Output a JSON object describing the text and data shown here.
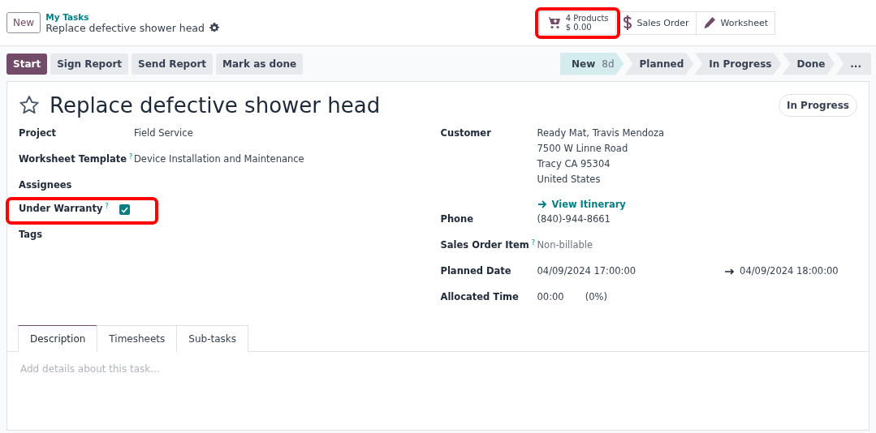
{
  "breadcrumb": {
    "new_button": "New",
    "parent": "My Tasks",
    "current": "Replace defective shower head"
  },
  "smart_buttons": [
    {
      "kind": "products",
      "line1": "4 Products",
      "line2": "$ 0.00",
      "highlighted": true
    },
    {
      "kind": "sales_order",
      "label": "Sales Order",
      "highlighted": false
    },
    {
      "kind": "worksheet",
      "label": "Worksheet",
      "highlighted": false
    }
  ],
  "actions": [
    {
      "label": "Start",
      "primary": true
    },
    {
      "label": "Sign Report",
      "primary": false
    },
    {
      "label": "Send Report",
      "primary": false
    },
    {
      "label": "Mark as done",
      "primary": false
    }
  ],
  "stages": [
    {
      "label": "New",
      "count": "8d",
      "selected": true
    },
    {
      "label": "Planned",
      "selected": false
    },
    {
      "label": "In Progress",
      "selected": false
    },
    {
      "label": "Done",
      "selected": false
    },
    {
      "label": "...",
      "selected": false
    }
  ],
  "record": {
    "title": "Replace defective shower head",
    "starred": false,
    "status": "In Progress"
  },
  "left_fields": [
    {
      "kind": "text",
      "label": "Project",
      "value": "Field Service"
    },
    {
      "kind": "text",
      "label": "Worksheet Template",
      "help": "?",
      "value": "Device Installation and Maintenance"
    },
    {
      "kind": "empty",
      "label": "Assignees"
    },
    {
      "kind": "checkbox",
      "label": "Under Warranty",
      "help": "?",
      "checked": true,
      "highlighted": true
    },
    {
      "kind": "empty",
      "label": "Tags"
    }
  ],
  "right_fields": [
    {
      "kind": "address",
      "label": "Customer",
      "lines": [
        "Ready Mat, Travis Mendoza",
        "7500 W Linne Road",
        "Tracy CA 95304",
        "United States"
      ],
      "link": "View Itinerary"
    },
    {
      "kind": "text",
      "label": "Phone",
      "value": "(840)-944-8661"
    },
    {
      "kind": "text",
      "label": "Sales Order Item",
      "help": "?",
      "placeholder": "Non-billable"
    },
    {
      "kind": "range",
      "label": "Planned Date",
      "start": "04/09/2024 17:00:00",
      "end": "04/09/2024 18:00:00"
    },
    {
      "kind": "pair",
      "label": "Allocated Time",
      "value": "00:00",
      "extra": "(0%)"
    }
  ],
  "tabs": [
    {
      "label": "Description",
      "selected": true
    },
    {
      "label": "Timesheets",
      "selected": false
    },
    {
      "label": "Sub-tasks",
      "selected": false
    }
  ],
  "description": {
    "placeholder": "Add details about this task..."
  }
}
